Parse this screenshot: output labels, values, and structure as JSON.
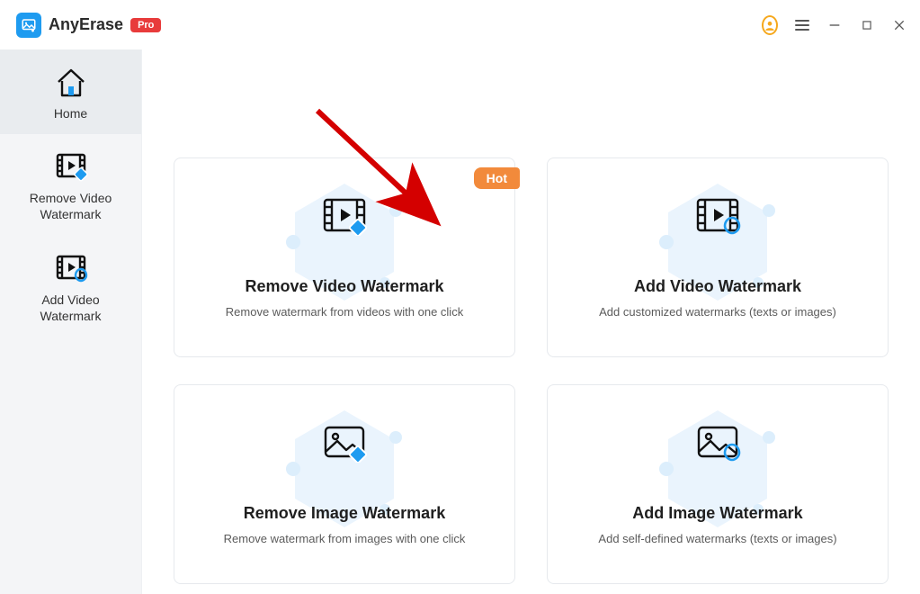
{
  "brand": {
    "name": "AnyErase",
    "badge": "Pro"
  },
  "sidebar": {
    "items": [
      {
        "label": "Home"
      },
      {
        "label": "Remove Video\nWatermark"
      },
      {
        "label": "Add Video\nWatermark"
      }
    ]
  },
  "cards": {
    "hot_label": "Hot",
    "items": [
      {
        "title": "Remove Video Watermark",
        "subtitle": "Remove watermark from videos with one click"
      },
      {
        "title": "Add Video Watermark",
        "subtitle": "Add customized watermarks (texts or images)"
      },
      {
        "title": "Remove Image Watermark",
        "subtitle": "Remove watermark from images with one click"
      },
      {
        "title": "Add Image Watermark",
        "subtitle": "Add self-defined watermarks  (texts or images)"
      }
    ]
  }
}
